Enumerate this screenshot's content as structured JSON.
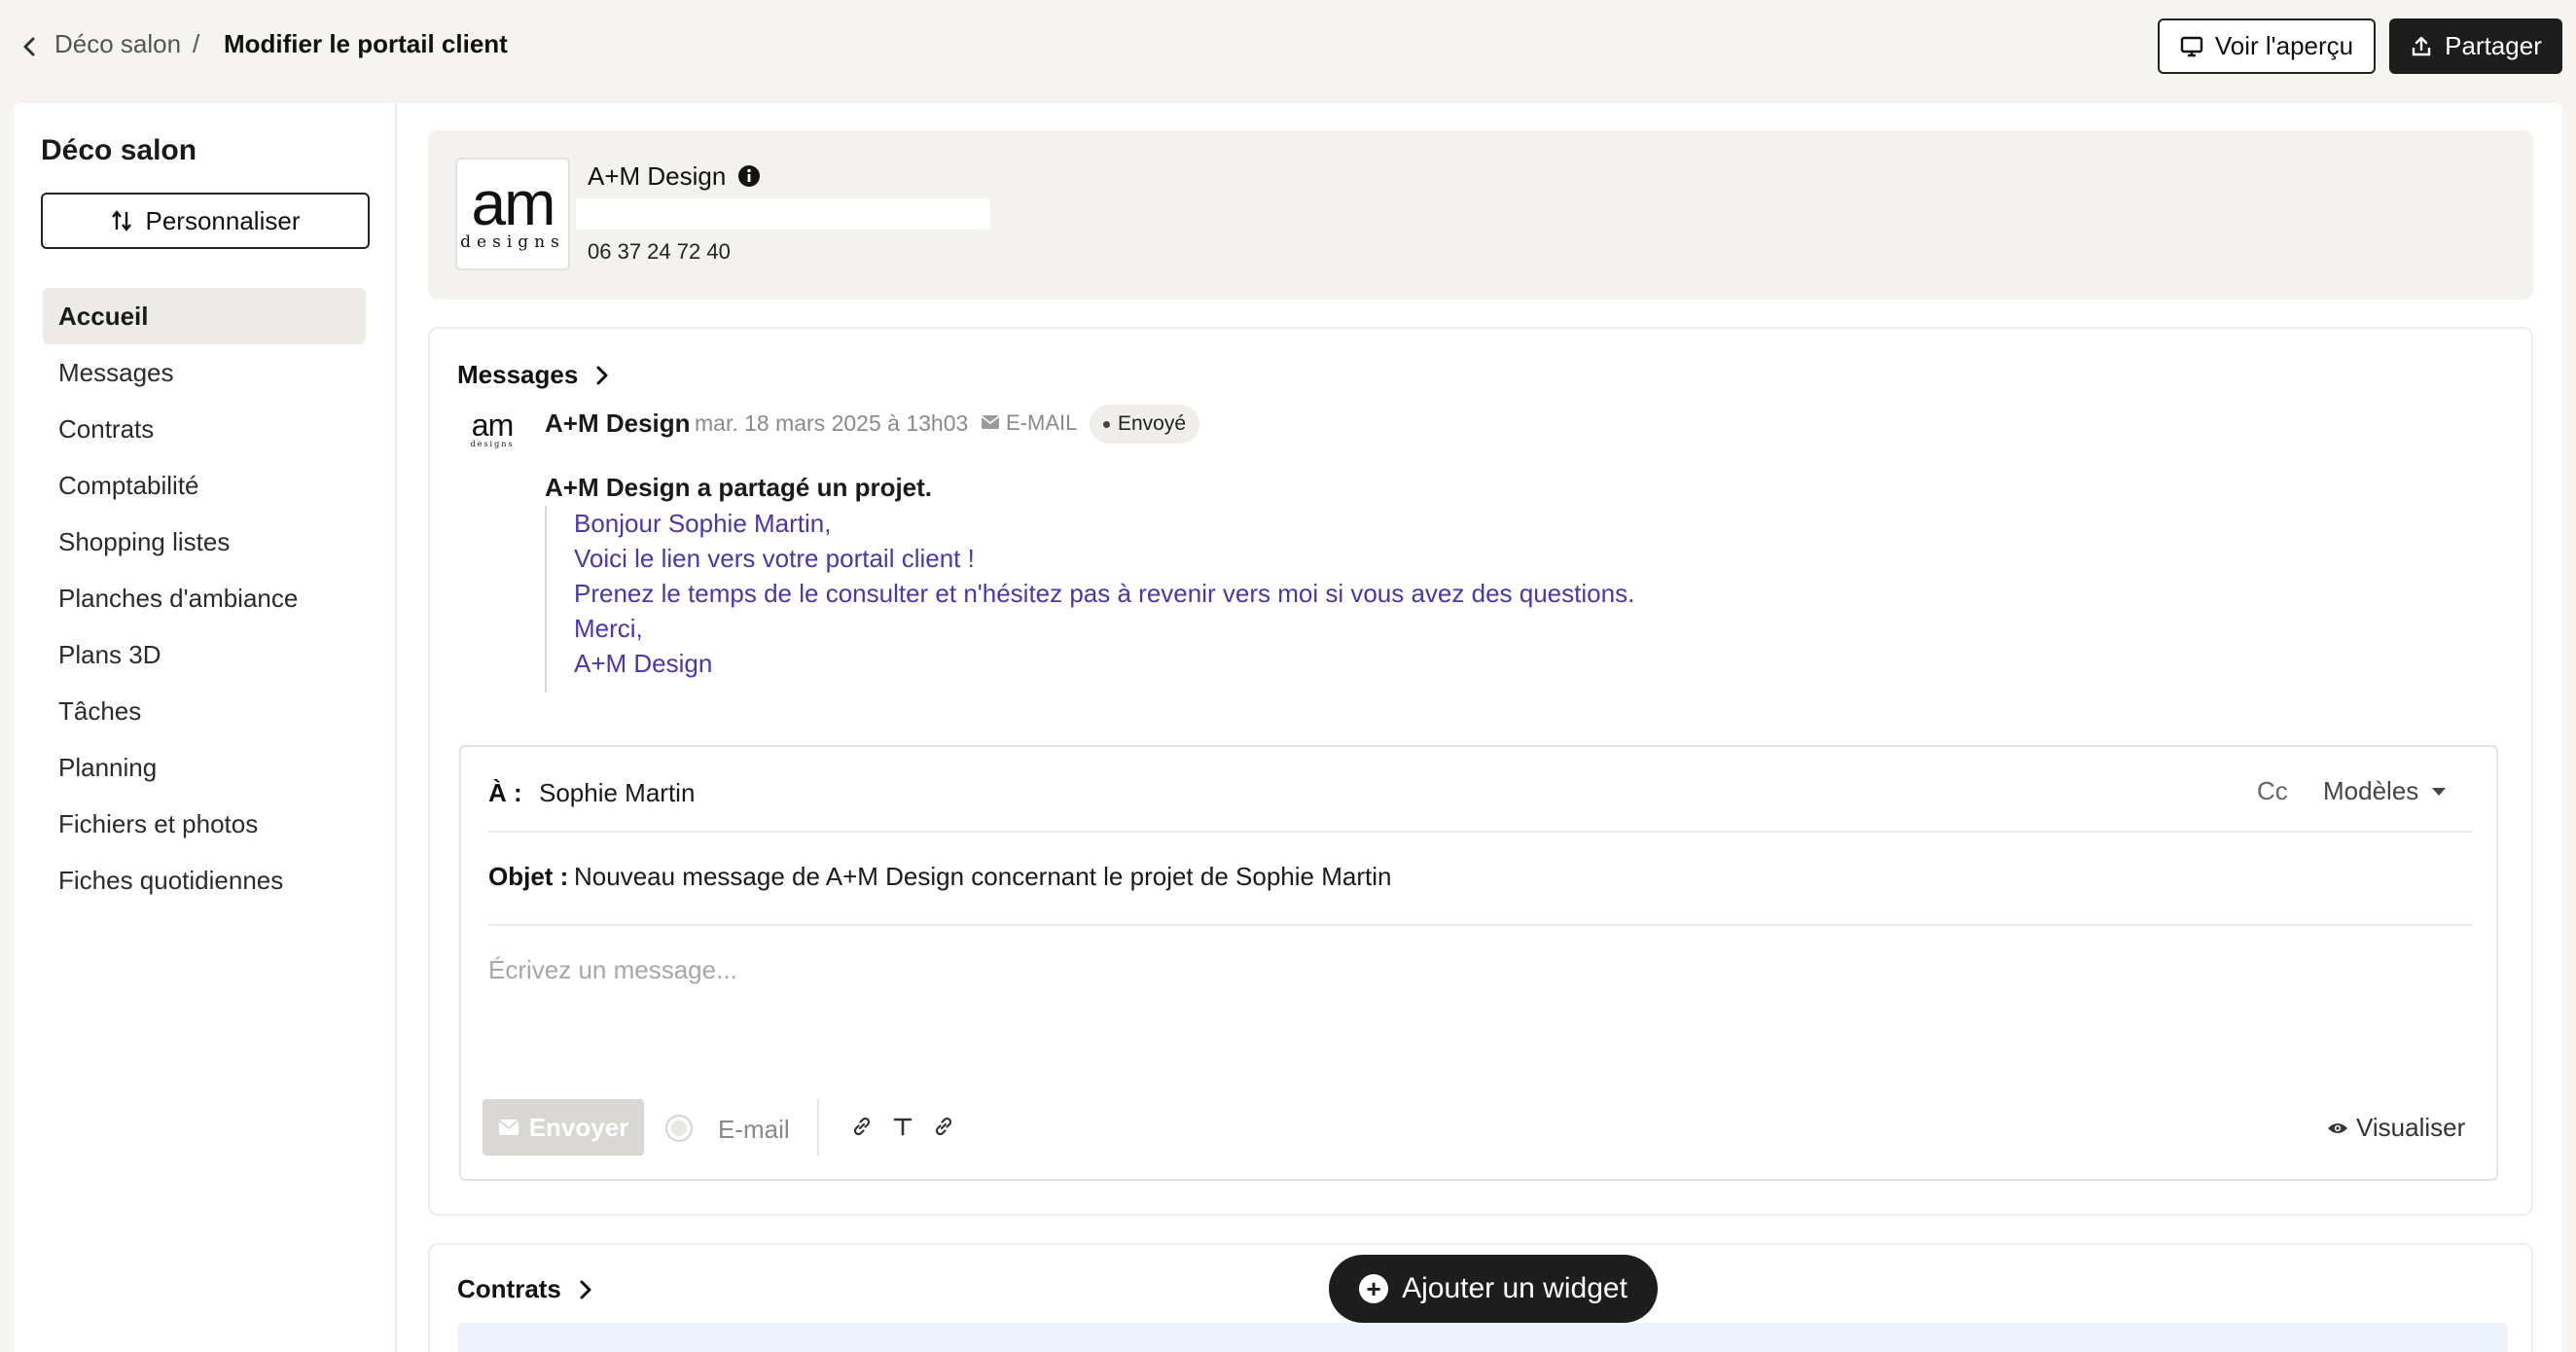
{
  "breadcrumb": {
    "project": "Déco salon",
    "separator": "/",
    "current": "Modifier le portail client"
  },
  "actions": {
    "preview_label": "Voir l'aperçu",
    "share_label": "Partager"
  },
  "sidebar": {
    "title": "Déco salon",
    "customize_label": "Personnaliser",
    "items": [
      {
        "label": "Accueil",
        "active": true
      },
      {
        "label": "Messages"
      },
      {
        "label": "Contrats"
      },
      {
        "label": "Comptabilité"
      },
      {
        "label": "Shopping listes"
      },
      {
        "label": "Planches d'ambiance"
      },
      {
        "label": "Plans 3D"
      },
      {
        "label": "Tâches"
      },
      {
        "label": "Planning"
      },
      {
        "label": "Fichiers et photos"
      },
      {
        "label": "Fiches quotidiennes"
      }
    ]
  },
  "company": {
    "logo_main": "am",
    "logo_sub": "designs",
    "name": "A+M Design",
    "phone": "06 37 24 72 40"
  },
  "messages": {
    "section_title": "Messages",
    "item": {
      "author": "A+M Design",
      "date": "mar. 18 mars 2025 à 13h03",
      "channel": "E-MAIL",
      "status": "Envoyé",
      "heading": "A+M Design a partagé un projet.",
      "lines": [
        "Bonjour Sophie Martin,",
        "Voici le lien vers votre portail client !",
        "Prenez le temps de le consulter et n'hésitez pas à revenir vers moi si vous avez des questions.",
        "Merci,",
        "A+M Design"
      ]
    },
    "composer": {
      "to_label": "À :",
      "to_value": "Sophie Martin",
      "cc_label": "Cc",
      "templates_label": "Modèles",
      "subject_label": "Objet :",
      "subject_value": "Nouveau message de A+M Design concernant le projet de Sophie Martin",
      "message_placeholder": "Écrivez un message...",
      "send_label": "Envoyer",
      "channel_label": "E-mail",
      "visualize_label": "Visualiser"
    }
  },
  "contracts": {
    "section_title": "Contrats"
  },
  "add_widget_label": "Ajouter un widget",
  "colors": {
    "background": "#f5f4f0",
    "accent_dark": "#1d1d1d",
    "quote_text": "#4a37a8",
    "active_nav": "#ecebe7"
  }
}
